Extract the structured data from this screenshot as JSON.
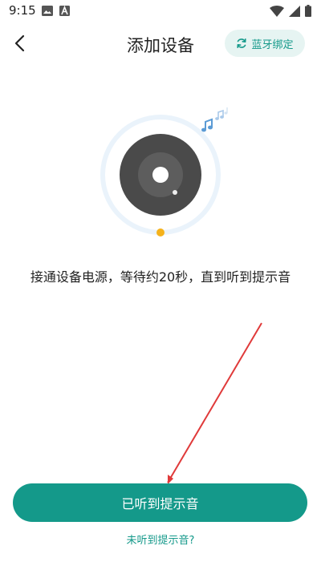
{
  "status_bar": {
    "time": "9:15",
    "left_icons": [
      "image-icon",
      "font-a-icon"
    ],
    "right_icons": [
      "wifi-icon",
      "cellular-icon",
      "battery-icon"
    ]
  },
  "header": {
    "title": "添加设备",
    "bluetooth_button_label": "蓝牙绑定"
  },
  "instruction": "接通设备电源，等待约20秒，直到听到提示音",
  "primary_button_label": "已听到提示音",
  "secondary_link_label": "未听到提示音?",
  "colors": {
    "accent": "#14998a",
    "accent_light": "#e6f4f2",
    "device": "#4a4a4a",
    "indicator": "#f5b21b",
    "arrow": "#e03a3a"
  }
}
